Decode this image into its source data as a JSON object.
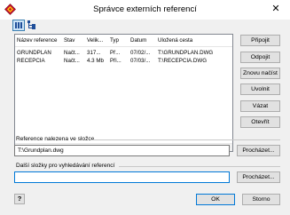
{
  "window": {
    "title": "Správce externích referencí",
    "close_glyph": "✕"
  },
  "toolbar": {
    "buttons": [
      {
        "name": "list-view-icon",
        "active": true
      },
      {
        "name": "tree-view-icon",
        "active": false
      }
    ]
  },
  "table": {
    "columns": [
      "Název reference",
      "Stav",
      "Velik...",
      "Typ",
      "Datum",
      "Uložená cesta"
    ],
    "rows": [
      [
        "GRUNDPLAN",
        "Načt...",
        "317...",
        "Př...",
        "07/02/...",
        "T:\\GRUNDPLAN.DWG"
      ],
      [
        "RECEPCIA",
        "Načt...",
        "4.3 Mb",
        "Při...",
        "07/03/...",
        "T:\\RECEPCIA.DWG"
      ]
    ]
  },
  "side_buttons": {
    "attach": "Připojit",
    "detach": "Odpojit",
    "reload": "Znovu načíst",
    "unload": "Uvolnit",
    "bind": "Vázat",
    "open": "Otevřít"
  },
  "found_in": {
    "label": "Reference nalezena ve složce",
    "value": "T:\\Grundplan.dwg",
    "browse": "Procházet..."
  },
  "search_folders": {
    "label": "Další složky pro vyhledávání referencí",
    "value": "",
    "browse": "Procházet..."
  },
  "footer": {
    "help": "?",
    "ok": "OK",
    "cancel": "Storno"
  }
}
